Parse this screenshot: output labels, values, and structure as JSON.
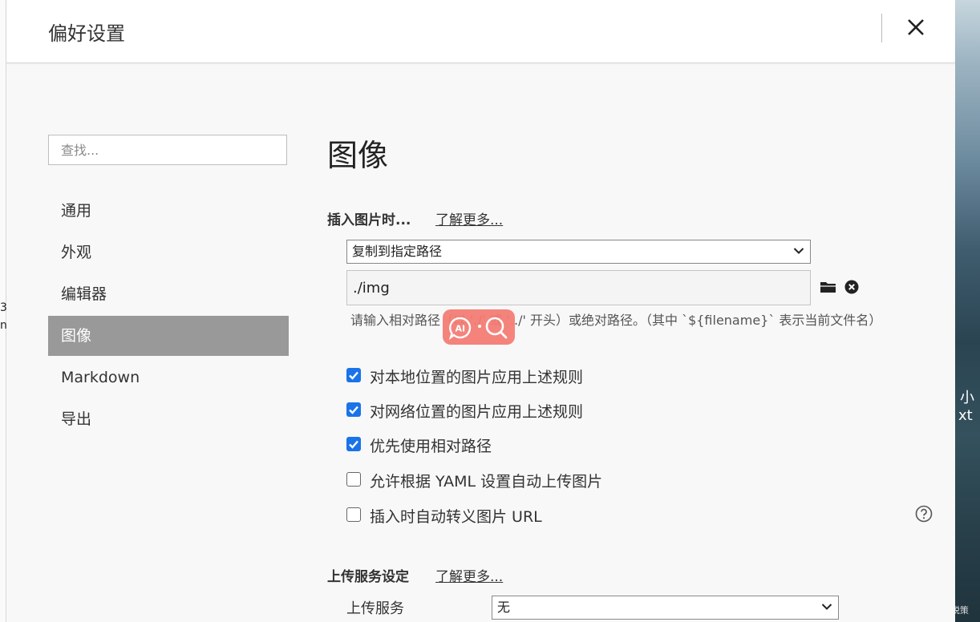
{
  "dialog": {
    "title": "偏好设置"
  },
  "sidebar": {
    "search_placeholder": "查找...",
    "items": [
      {
        "label": "通用"
      },
      {
        "label": "外观"
      },
      {
        "label": "编辑器"
      },
      {
        "label": "图像",
        "active": true
      },
      {
        "label": "Markdown"
      },
      {
        "label": "导出"
      }
    ]
  },
  "main": {
    "page_title": "图像",
    "insert_section": {
      "label": "插入图片时...",
      "learn_more": "了解更多...",
      "action_select_value": "复制到指定路径",
      "path_value": "./img",
      "hint": "请输入相对路径（以 './' 或 '../' 开头）或绝对路径。（其中 `${filename}` 表示当前文件名）",
      "options": [
        {
          "label": "对本地位置的图片应用上述规则",
          "checked": true
        },
        {
          "label": "对网络位置的图片应用上述规则",
          "checked": true
        },
        {
          "label": "优先使用相对路径",
          "checked": true
        },
        {
          "label": "允许根据 YAML 设置自动上传图片",
          "checked": false
        },
        {
          "label": "插入时自动转义图片 URL",
          "checked": false
        }
      ]
    },
    "upload_section": {
      "label": "上传服务设定",
      "learn_more": "了解更多...",
      "service_label": "上传服务",
      "service_value": "无"
    }
  },
  "background": {
    "right_text_1": "小",
    "right_text_2": "xt",
    "left_fragments": [
      "3",
      "n"
    ],
    "watermark": "CSDN @锐策"
  },
  "colors": {
    "accent": "#1a73e8",
    "nav_active_bg": "#999999",
    "ai_float_bg": "#f47b73"
  },
  "icons": {
    "close": "close-icon",
    "folder": "folder-icon",
    "clear": "clear-circle-icon",
    "help": "help-circle-icon",
    "chevron": "chevron-down-icon"
  }
}
